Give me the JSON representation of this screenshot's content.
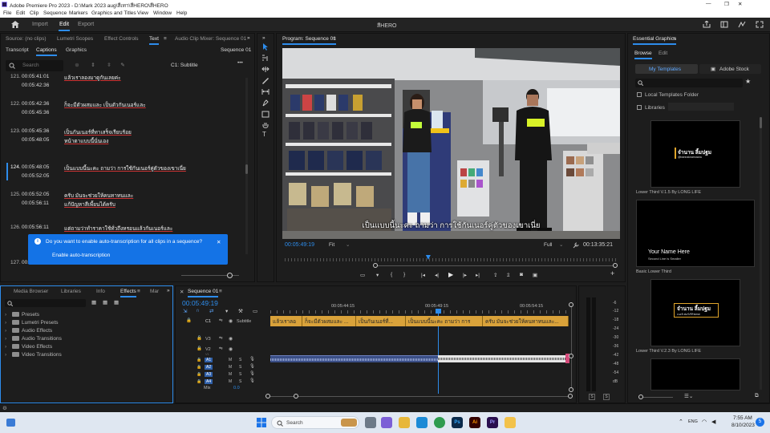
{
  "window": {
    "title": "Adobe Premiere Pro 2023 - D:\\Mark 2023 aug\\สีเทา\\สีHERO\\สีHERO",
    "min": "—",
    "max": "❐",
    "close": "✕"
  },
  "menu": [
    "File",
    "Edit",
    "Clip",
    "Sequence",
    "Markers",
    "Graphics and Titles",
    "View",
    "Window",
    "Help"
  ],
  "header": {
    "home_icon": "home-icon",
    "tabs": [
      "Import",
      "Edit",
      "Export"
    ],
    "active": "Edit",
    "project_title": "สีHERO"
  },
  "source_panel": {
    "tabs": [
      "Source: (no clips)",
      "Lumetri Scopes",
      "Effect Controls",
      "Text",
      "Audio Clip Mixer: Sequence 01"
    ],
    "active": "Text",
    "subtabs": [
      "Transcript",
      "Captions",
      "Graphics"
    ],
    "subtab_active": "Captions",
    "sequence_label": "Sequence 01",
    "search_placeholder": "Search",
    "track_label": "C1: Subtitle",
    "captions": [
      {
        "num": "121.",
        "in": "00:05:41:01",
        "out": "00:05:42:36",
        "line1": "แล้วเราลองมาดูกันเลยค่ะ",
        "line2": ""
      },
      {
        "num": "122.",
        "in": "00:05:42:36",
        "out": "00:05:45:36",
        "line1": "ก็จะมีตัวผสมและ เป็นตัวกันเนอร์และ",
        "line2": ""
      },
      {
        "num": "123.",
        "in": "00:05:45:36",
        "out": "00:05:48:05",
        "line1": "เป็นกันเนอร์ที่ทาเสร็จเรียบร้อย",
        "line2": "หน้าตาแบบนี้นั่นเอง"
      },
      {
        "num": "124.",
        "in": "00:05:48:05",
        "out": "00:05:52:05",
        "line1": "เป็นแบบนี้นะคะ ถามว่า การใช้กันเนอร์คู่ตัวของเขาเนี่ย",
        "line2": ""
      },
      {
        "num": "125.",
        "in": "00:05:52:05",
        "out": "00:05:56:11",
        "line1": "ครับ มันจะช่วยให้คนทาทนและ",
        "line2": "แก้ปัญหาสีเพี้ยนได้ครับ"
      },
      {
        "num": "126.",
        "in": "00:05:56:11",
        "out": "",
        "line1": "แต่ถามว่าทำราคาใช้ทั่วถึงหรอนแล้วกันเนอร์และ",
        "line2": ""
      },
      {
        "num": "127.",
        "in": "00:06:",
        "out": "",
        "line1": "",
        "line2": ""
      }
    ],
    "toast": {
      "message": "Do you want to enable auto-transcription for all clips in a sequence?",
      "action": "Enable auto-transcription",
      "close": "✕"
    }
  },
  "program": {
    "title": "Program: Sequence 01",
    "subtitle": "เป็นแบบนี้นะคะ ถามว่า การใช้กันเนอร์คู่ตัวของเขาเนี่ย",
    "timecode": "00:05:49:19",
    "fit": "Fit",
    "quality": "Full",
    "duration": "00:13:35:21",
    "playhead_fraction": 0.43
  },
  "project_panel": {
    "tabs": [
      "Media Browser",
      "Libraries",
      "Info",
      "Effects",
      "Mar"
    ],
    "active": "Effects",
    "folders": [
      "Presets",
      "Lumetri Presets",
      "Audio Effects",
      "Audio Transitions",
      "Video Effects",
      "Video Transitions"
    ]
  },
  "timeline": {
    "sequence_tab": "Sequence 01",
    "timecode": "00:05:49:19",
    "ruler": [
      "00:05:44:15",
      "00:05:49:15",
      "00:05:54:15"
    ],
    "caption_track": "C1",
    "caption_track_name": "Subtitle",
    "video_tracks": [
      "V3",
      "V2",
      "V1"
    ],
    "audio_tracks": [
      "A1",
      "A2",
      "A3",
      "A4"
    ],
    "mix_label": "Mix",
    "mix_value": "0.0",
    "clips": [
      "แล้วเราลอ",
      "ก็จะมีตัวผสมและ ...",
      "เป็นกันเนอร์ที่...",
      "เป็นแบบนี้นะคะ ถามว่า การ",
      "ครับ มันจะช่วยให้คนทาทนและ..."
    ],
    "meter_labels": [
      "-6",
      "-12",
      "-18",
      "-24",
      "-30",
      "-36",
      "-42",
      "-48",
      "-54",
      "dB"
    ],
    "meter_buttons": [
      "S",
      "S"
    ]
  },
  "essential_graphics": {
    "title": "Essential Graphics",
    "tabs": [
      "Browse",
      "Edit"
    ],
    "active": "Browse",
    "sources": [
      "My Templates",
      "Adobe Stock"
    ],
    "source_active": "My Templates",
    "checkbox_local": "Local Templates Folder",
    "checkbox_libraries": "Libraries",
    "templates": [
      {
        "label": "Lower Third V.1.5 By LONG LIFE",
        "preview_text": "จำนาน ลิ้มปฐม",
        "preview_sub": "@bannaknamuwou"
      },
      {
        "label": "Basic Lower Third",
        "preview_text": "Your Name Here",
        "preview_sub": "Second Line is Smaller"
      },
      {
        "label": "Lower Third V.2.3 By LONG LIFE",
        "preview_text": "จำนาน ลิ้มปฐม",
        "preview_sub": "เบอร์เฟอร์เซิร์ฟเทศ"
      }
    ]
  },
  "taskbar": {
    "search_placeholder": "Search",
    "time": "7:55 AM",
    "date": "8/10/2023",
    "lang": "ENG",
    "notif_count": "5"
  }
}
